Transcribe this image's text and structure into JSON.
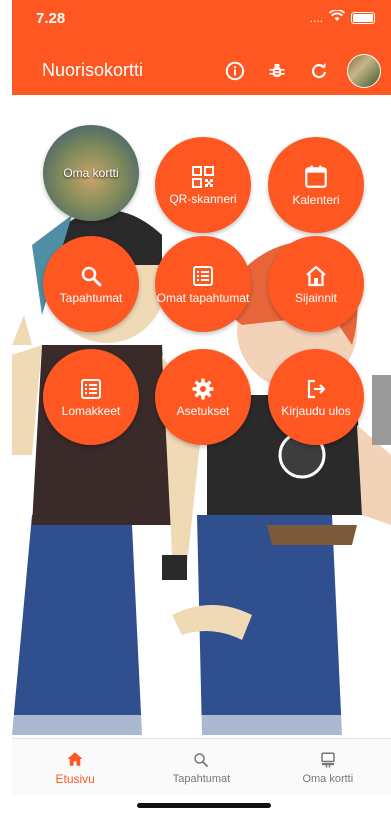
{
  "status_bar": {
    "time": "7.28",
    "signal_text": "...."
  },
  "app_bar": {
    "title": "Nuorisokortti",
    "actions": [
      {
        "name": "info-icon"
      },
      {
        "name": "bug-icon"
      },
      {
        "name": "refresh-icon"
      },
      {
        "name": "profile-avatar"
      }
    ]
  },
  "menu": {
    "my_card": "Oma kortti",
    "qr": "QR-skanneri",
    "calendar": "Kalenteri",
    "events": "Tapahtumat",
    "my_events": "Omat tapahtumat",
    "locations": "Sijainnit",
    "forms": "Lomakkeet",
    "settings": "Asetukset",
    "logout": "Kirjaudu ulos"
  },
  "bottom_nav": {
    "home": "Etusivu",
    "events": "Tapahtumat",
    "card": "Oma kortti"
  },
  "colors": {
    "accent": "#ff5722",
    "inactive": "#777777"
  }
}
